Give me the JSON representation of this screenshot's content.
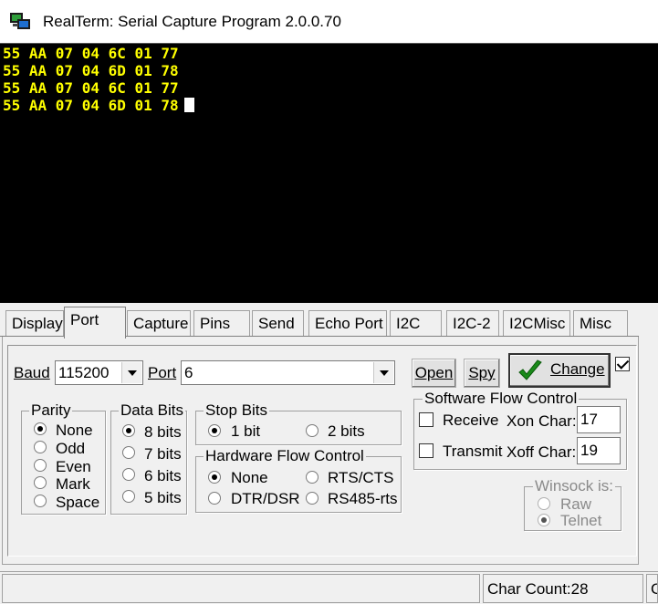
{
  "window": {
    "title": "RealTerm: Serial Capture Program 2.0.0.70",
    "icon": "realterm-app-icon"
  },
  "terminal": {
    "lines": [
      "55 AA 07 04 6C 01 77",
      "55 AA 07 04 6D 01 78",
      "55 AA 07 04 6C 01 77",
      "55 AA 07 04 6D 01 78"
    ],
    "text_color": "#ffff00",
    "background": "#000000"
  },
  "tabs": [
    {
      "label": "Display",
      "active": false
    },
    {
      "label": "Port",
      "active": true
    },
    {
      "label": "Capture",
      "active": false
    },
    {
      "label": "Pins",
      "active": false
    },
    {
      "label": "Send",
      "active": false
    },
    {
      "label": "Echo Port",
      "active": false
    },
    {
      "label": "I2C",
      "active": false
    },
    {
      "label": "I2C-2",
      "active": false
    },
    {
      "label": "I2CMisc",
      "active": false
    },
    {
      "label": "Misc",
      "active": false
    }
  ],
  "port": {
    "baud_label": "Baud",
    "baud_value": "115200",
    "port_label": "Port",
    "port_value": "6",
    "open_label": "Open",
    "spy_label": "Spy",
    "change_label": "Change",
    "change_checked": true
  },
  "parity": {
    "title": "Parity",
    "options": [
      "None",
      "Odd",
      "Even",
      "Mark",
      "Space"
    ],
    "selected": "None"
  },
  "data_bits": {
    "title": "Data Bits",
    "options": [
      "8 bits",
      "7 bits",
      "6 bits",
      "5 bits"
    ],
    "selected": "8 bits"
  },
  "stop_bits": {
    "title": "Stop Bits",
    "options": [
      "1 bit",
      "2 bits"
    ],
    "selected": "1 bit"
  },
  "hw_flow": {
    "title": "Hardware Flow Control",
    "options": [
      "None",
      "RTS/CTS",
      "DTR/DSR",
      "RS485-rts"
    ],
    "selected": "None"
  },
  "sw_flow": {
    "title": "Software Flow Control",
    "receive_label": "Receive",
    "transmit_label": "Transmit",
    "xon_label": "Xon Char:",
    "xon_value": "17",
    "xoff_label": "Xoff Char:",
    "xoff_value": "19"
  },
  "winsock": {
    "title": "Winsock is:",
    "options": [
      "Raw",
      "Telnet"
    ],
    "selected": "Telnet"
  },
  "status": {
    "char_count": "Char Count:28",
    "next_cell": "C"
  }
}
